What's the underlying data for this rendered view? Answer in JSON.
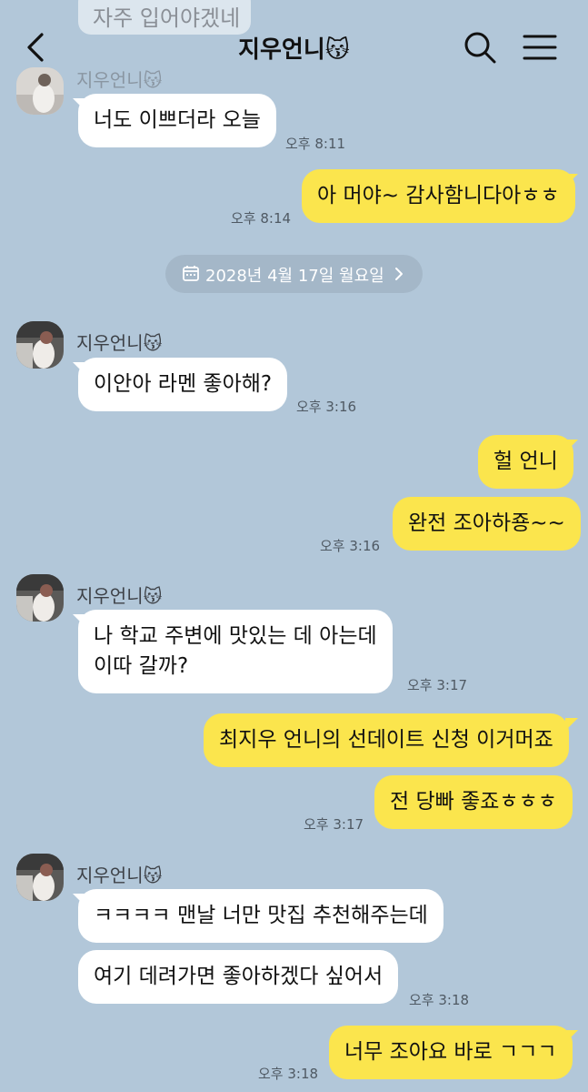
{
  "header": {
    "previous_message": "자주 입어야겠네",
    "title": "지우언니😽"
  },
  "contact": {
    "name": "지우언니😽"
  },
  "date_divider": "2028년 4월 17일 월요일",
  "messages": [
    {
      "text": "너도 이쁘더라 오늘",
      "time": "오후 8:11"
    },
    {
      "text": "아 머야~ 감사함니다아ㅎㅎ",
      "time": "오후 8:14"
    },
    {
      "text": "이안아 라멘 좋아해?",
      "time": "오후 3:16"
    },
    {
      "text": "헐 언니"
    },
    {
      "text": "완전 조아하죵~~",
      "time": "오후 3:16"
    },
    {
      "line1": "나 학교 주변에 맛있는 데 아는데",
      "line2": "이따 갈까?",
      "time": "오후 3:17"
    },
    {
      "text": "최지우 언니의 선데이트 신청 이거머죠"
    },
    {
      "text": "전 당빠 좋죠ㅎㅎㅎ",
      "time": "오후 3:17"
    },
    {
      "text": "ㅋㅋㅋㅋ 맨날 너만 맛집 추천해주는데"
    },
    {
      "text": "여기 데려가면 좋아하겠다 싶어서",
      "time": "오후 3:18"
    },
    {
      "text": "너무 조아요 바로 ㄱㄱㄱ",
      "time": "오후 3:18"
    }
  ]
}
